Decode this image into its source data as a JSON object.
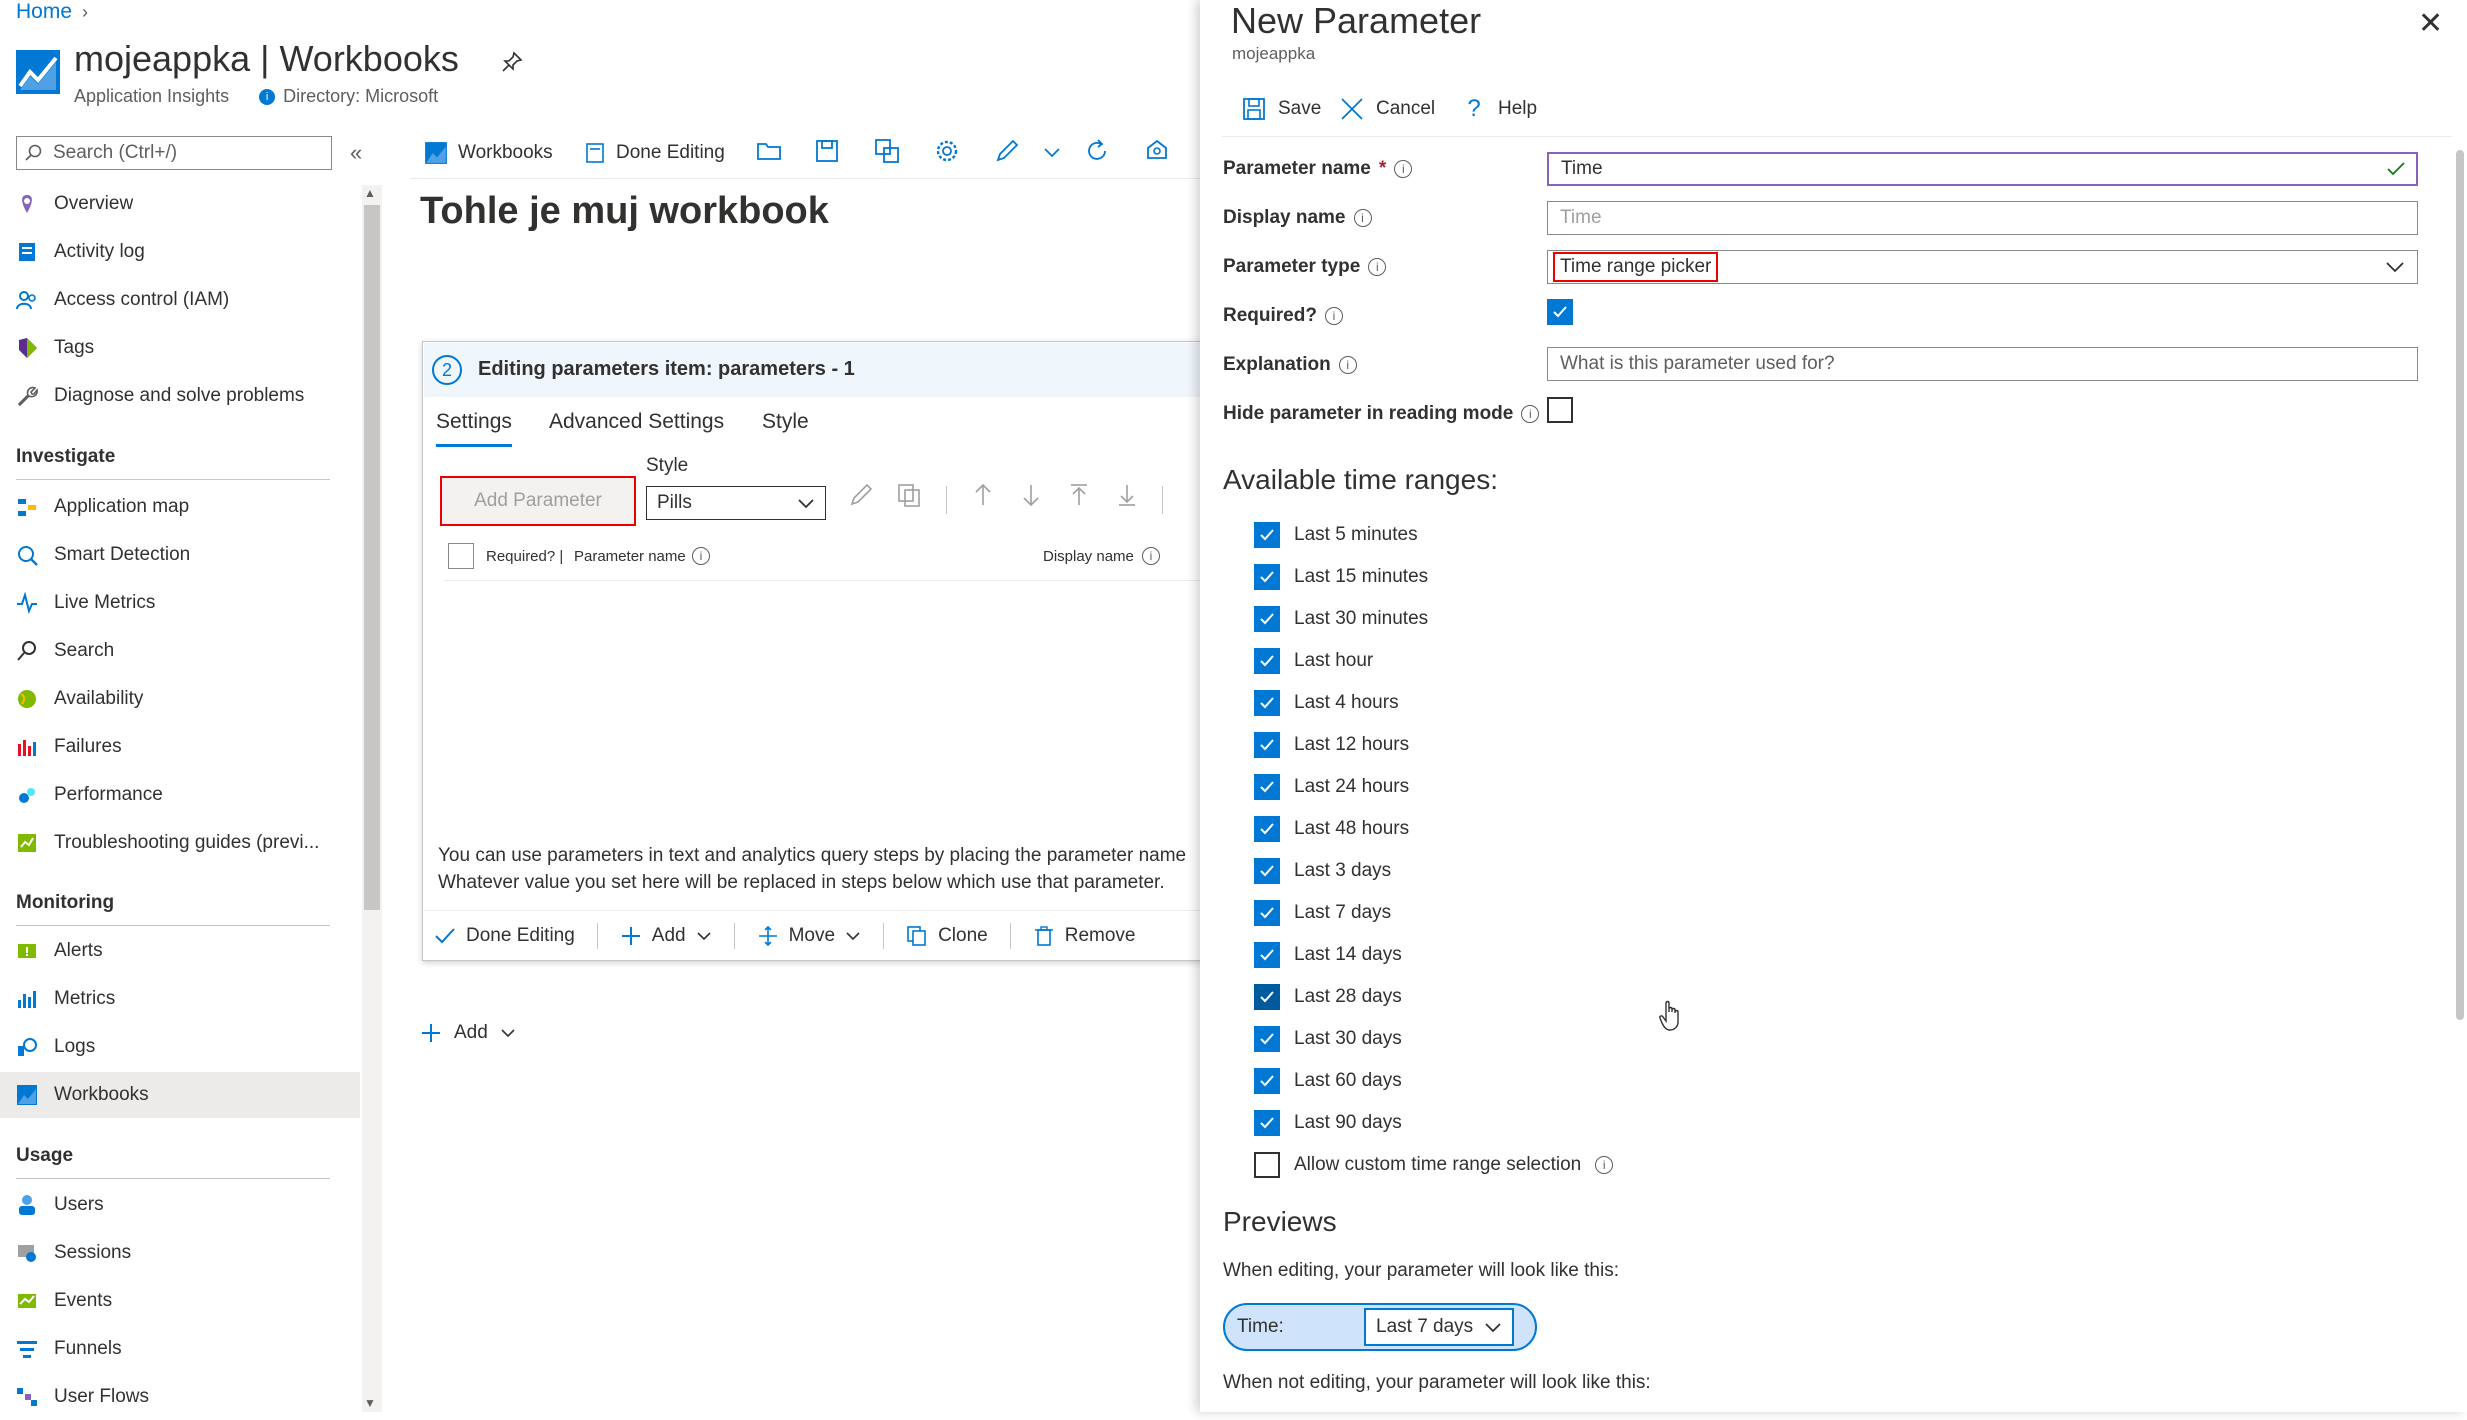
{
  "breadcrumb": {
    "home": "Home"
  },
  "app": {
    "name": "mojeappka | Workbooks",
    "type": "Application Insights",
    "directory": "Directory: Microsoft"
  },
  "sidebar": {
    "search_placeholder": "Search (Ctrl+/)",
    "top_items": [
      "Overview",
      "Activity log",
      "Access control (IAM)",
      "Tags",
      "Diagnose and solve problems"
    ],
    "investigate_header": "Investigate",
    "investigate_items": [
      "Application map",
      "Smart Detection",
      "Live Metrics",
      "Search",
      "Availability",
      "Failures",
      "Performance",
      "Troubleshooting guides (previ..."
    ],
    "monitoring_header": "Monitoring",
    "monitoring_items": [
      "Alerts",
      "Metrics",
      "Logs",
      "Workbooks"
    ],
    "usage_header": "Usage",
    "usage_items": [
      "Users",
      "Sessions",
      "Events",
      "Funnels",
      "User Flows"
    ]
  },
  "toolbar": {
    "workbooks": "Workbooks",
    "done_editing": "Done Editing"
  },
  "workbook": {
    "title": "Tohle je muj workbook"
  },
  "card": {
    "step": "2",
    "title": "Editing parameters item: parameters - 1",
    "tabs": [
      "Settings",
      "Advanced Settings",
      "Style"
    ],
    "add_parameter": "Add Parameter",
    "style_label": "Style",
    "style_value": "Pills",
    "col_required": "Required? |",
    "col_param_name": "Parameter name",
    "col_display_name": "Display name",
    "info_line1": "You can use parameters in text and analytics query steps by placing the parameter name",
    "info_line2": "Whatever value you set here will be replaced in steps below which use that parameter.",
    "footer": {
      "done": "Done Editing",
      "add": "Add",
      "move": "Move",
      "clone": "Clone",
      "remove": "Remove"
    }
  },
  "add_below": "Add",
  "panel": {
    "title": "New Parameter",
    "subtitle": "mojeappka",
    "save": "Save",
    "cancel": "Cancel",
    "help": "Help",
    "param_name_label": "Parameter name",
    "param_name_value": "Time",
    "display_name_label": "Display name",
    "display_name_placeholder": "Time",
    "param_type_label": "Parameter type",
    "param_type_value": "Time range picker",
    "required_label": "Required?",
    "explanation_label": "Explanation",
    "explanation_placeholder": "What is this parameter used for?",
    "hide_label": "Hide parameter in reading mode",
    "ranges_header": "Available time ranges:",
    "ranges": [
      "Last 5 minutes",
      "Last 15 minutes",
      "Last 30 minutes",
      "Last hour",
      "Last 4 hours",
      "Last 12 hours",
      "Last 24 hours",
      "Last 48 hours",
      "Last 3 days",
      "Last 7 days",
      "Last 14 days",
      "Last 28 days",
      "Last 30 days",
      "Last 60 days",
      "Last 90 days"
    ],
    "custom_range": "Allow custom time range selection",
    "previews_header": "Previews",
    "preview_editing": "When editing, your parameter will look like this:",
    "preview_label": "Time:",
    "preview_value": "Last 7 days",
    "preview_not_editing": "When not editing, your parameter will look like this:"
  },
  "colors": {
    "accent": "#0078d4",
    "highlight": "#e00000",
    "valid": "#8764b8"
  }
}
